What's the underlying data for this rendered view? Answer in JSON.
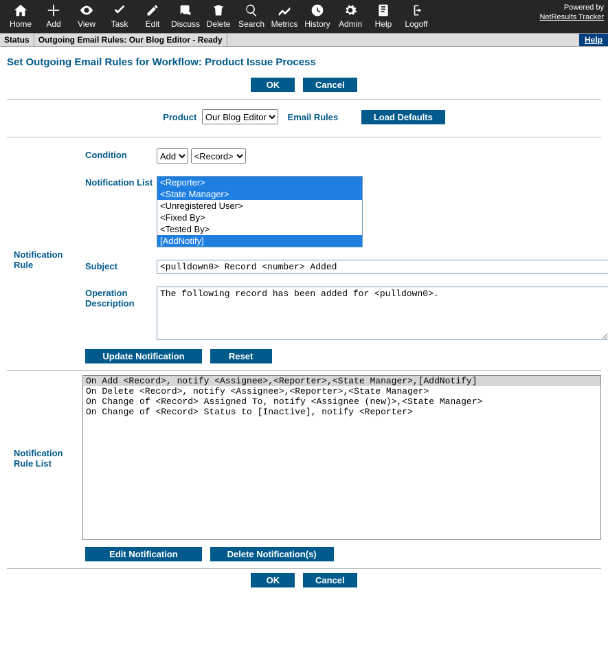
{
  "toolbar": {
    "items": [
      {
        "id": "home",
        "label": "Home"
      },
      {
        "id": "add",
        "label": "Add"
      },
      {
        "id": "view",
        "label": "View"
      },
      {
        "id": "task",
        "label": "Task"
      },
      {
        "id": "edit",
        "label": "Edit"
      },
      {
        "id": "discuss",
        "label": "Discuss"
      },
      {
        "id": "delete",
        "label": "Delete"
      },
      {
        "id": "search",
        "label": "Search"
      },
      {
        "id": "metrics",
        "label": "Metrics"
      },
      {
        "id": "history",
        "label": "History"
      },
      {
        "id": "admin",
        "label": "Admin"
      },
      {
        "id": "help",
        "label": "Help"
      },
      {
        "id": "logoff",
        "label": "Logoff"
      }
    ],
    "powered_by": "Powered by",
    "powered_link": "NetResults Tracker"
  },
  "statusbar": {
    "label": "Status",
    "message": "Outgoing Email Rules: Our Blog Editor - Ready",
    "help": "Help"
  },
  "page": {
    "title": "Set Outgoing Email Rules for Workflow: Product Issue Process",
    "ok": "OK",
    "cancel": "Cancel",
    "product_label": "Product",
    "product_selected": "Our Blog Editor",
    "email_rules_link": "Email Rules",
    "load_defaults": "Load Defaults"
  },
  "rule": {
    "side_label": "Notification Rule",
    "condition_label": "Condition",
    "condition_action": "Add",
    "condition_target": "<Record>",
    "notify_label": "Notification List",
    "notify_options": [
      {
        "text": "<Reporter>",
        "selected": true
      },
      {
        "text": "<State Manager>",
        "selected": true
      },
      {
        "text": "<Unregistered User>",
        "selected": false
      },
      {
        "text": "<Fixed By>",
        "selected": false
      },
      {
        "text": "<Tested By>",
        "selected": false
      },
      {
        "text": "[AddNotify]",
        "selected": true
      }
    ],
    "subject_label": "Subject",
    "subject_value": "<pulldown0> Record <number> Added",
    "opdesc_label": "Operation Description",
    "opdesc_value": "The following record has been added for <pulldown0>.",
    "update_btn": "Update Notification",
    "reset_btn": "Reset"
  },
  "rule_list": {
    "side_label": "Notification Rule List",
    "lines": [
      {
        "text": "On Add <Record>, notify <Assignee>,<Reporter>,<State Manager>,[AddNotify]",
        "selected": true
      },
      {
        "text": "On Delete <Record>, notify <Assignee>,<Reporter>,<State Manager>",
        "selected": false
      },
      {
        "text": "On Change of <Record> Assigned To, notify <Assignee (new)>,<State Manager>",
        "selected": false
      },
      {
        "text": "On Change of <Record> Status to [Inactive], notify <Reporter>",
        "selected": false
      }
    ],
    "edit_btn": "Edit Notification",
    "delete_btn": "Delete Notification(s)"
  }
}
